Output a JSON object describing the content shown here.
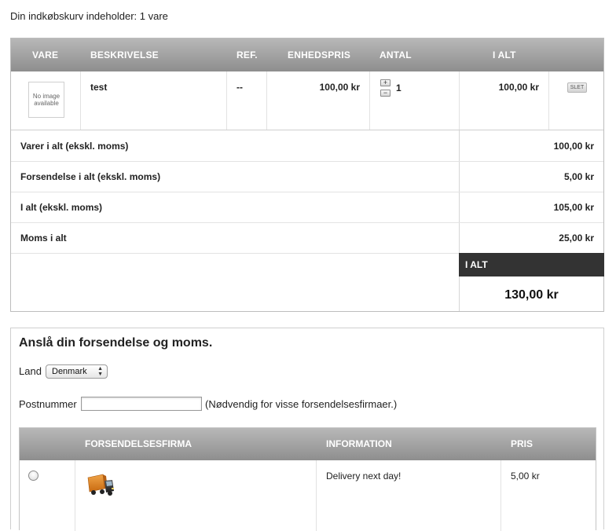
{
  "cart_summary": "Din indkøbskurv indeholder: 1 vare",
  "cart_table": {
    "headers": {
      "item": "VARE",
      "description": "BESKRIVELSE",
      "ref": "REF.",
      "unit_price": "ENHEDSPRIS",
      "quantity": "ANTAL",
      "total": "I ALT"
    },
    "rows": [
      {
        "image_text": "No image available",
        "description": "test",
        "ref": "--",
        "unit_price": "100,00 kr",
        "quantity": "1",
        "increment": "+",
        "decrement": "−",
        "total": "100,00 kr",
        "delete_label": "SLET"
      }
    ]
  },
  "totals": {
    "items_label": "Varer i alt (ekskl. moms)",
    "items_value": "100,00 kr",
    "shipping_label": "Forsendelse i alt (ekskl. moms)",
    "shipping_value": "5,00 kr",
    "subtotal_label": "I alt (ekskl. moms)",
    "subtotal_value": "105,00 kr",
    "vat_label": "Moms i alt",
    "vat_value": "25,00 kr",
    "grand_total_label": "I ALT",
    "grand_total_value": "130,00 kr"
  },
  "estimate": {
    "title": "Anslå din forsendelse og moms.",
    "country_label": "Land",
    "country_selected": "Denmark",
    "postcode_label": "Postnummer",
    "postcode_value": "",
    "postcode_note": "(Nødvendig for visse forsendelsesfirmaer.)",
    "shipping_table": {
      "headers": {
        "carrier": "FORSENDELSESFIRMA",
        "info": "INFORMATION",
        "price": "PRIS"
      },
      "rows": [
        {
          "icon": "truck-icon",
          "info": "Delivery next day!",
          "price": "5,00 kr"
        }
      ]
    }
  }
}
